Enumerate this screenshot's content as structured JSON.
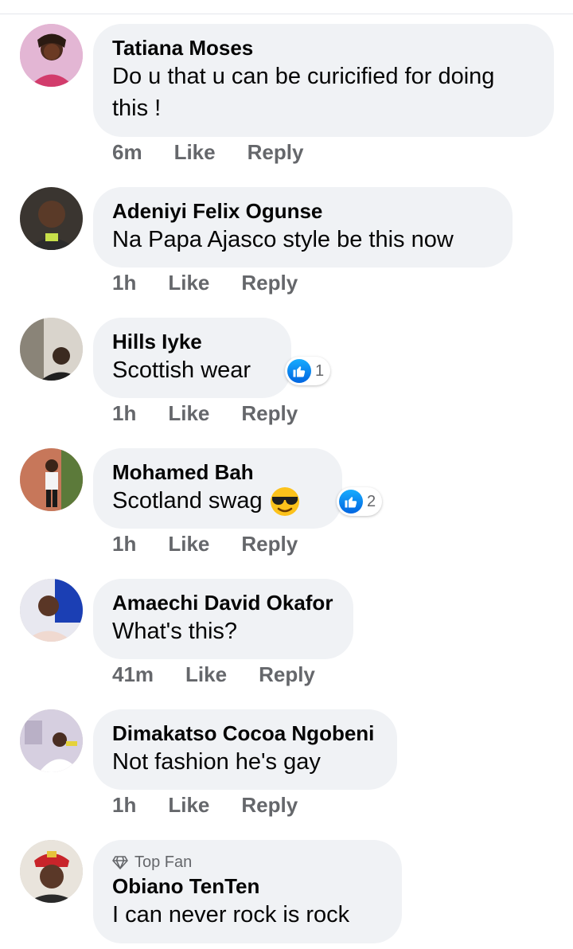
{
  "comments": [
    {
      "author": "Tatiana Moses",
      "text": "Do u that u can be curicified for doing this !",
      "time": "6m",
      "like": "Like",
      "reply": "Reply"
    },
    {
      "author": "Adeniyi Felix Ogunse",
      "text": "Na Papa Ajasco style be this now",
      "time": "1h",
      "like": "Like",
      "reply": "Reply"
    },
    {
      "author": "Hills Iyke",
      "text": "Scottish wear",
      "time": "1h",
      "like": "Like",
      "reply": "Reply",
      "reaction_count": "1"
    },
    {
      "author": "Mohamed Bah",
      "text": "Scotland swag",
      "emoji": "smiling-face-with-sunglasses",
      "time": "1h",
      "like": "Like",
      "reply": "Reply",
      "reaction_count": "2"
    },
    {
      "author": "Amaechi David Okafor",
      "text": "What's this?",
      "time": "41m",
      "like": "Like",
      "reply": "Reply"
    },
    {
      "author": "Dimakatso Cocoa Ngobeni",
      "text": "Not fashion he's gay",
      "time": "1h",
      "like": "Like",
      "reply": "Reply"
    },
    {
      "badge": "Top Fan",
      "badge_icon": "diamond-icon",
      "author": "Obiano TenTen",
      "text": "I can never rock is rock"
    }
  ],
  "colors": {
    "bubble": "#f0f2f5",
    "meta": "#65676b",
    "like_blue": "#0866ff"
  }
}
